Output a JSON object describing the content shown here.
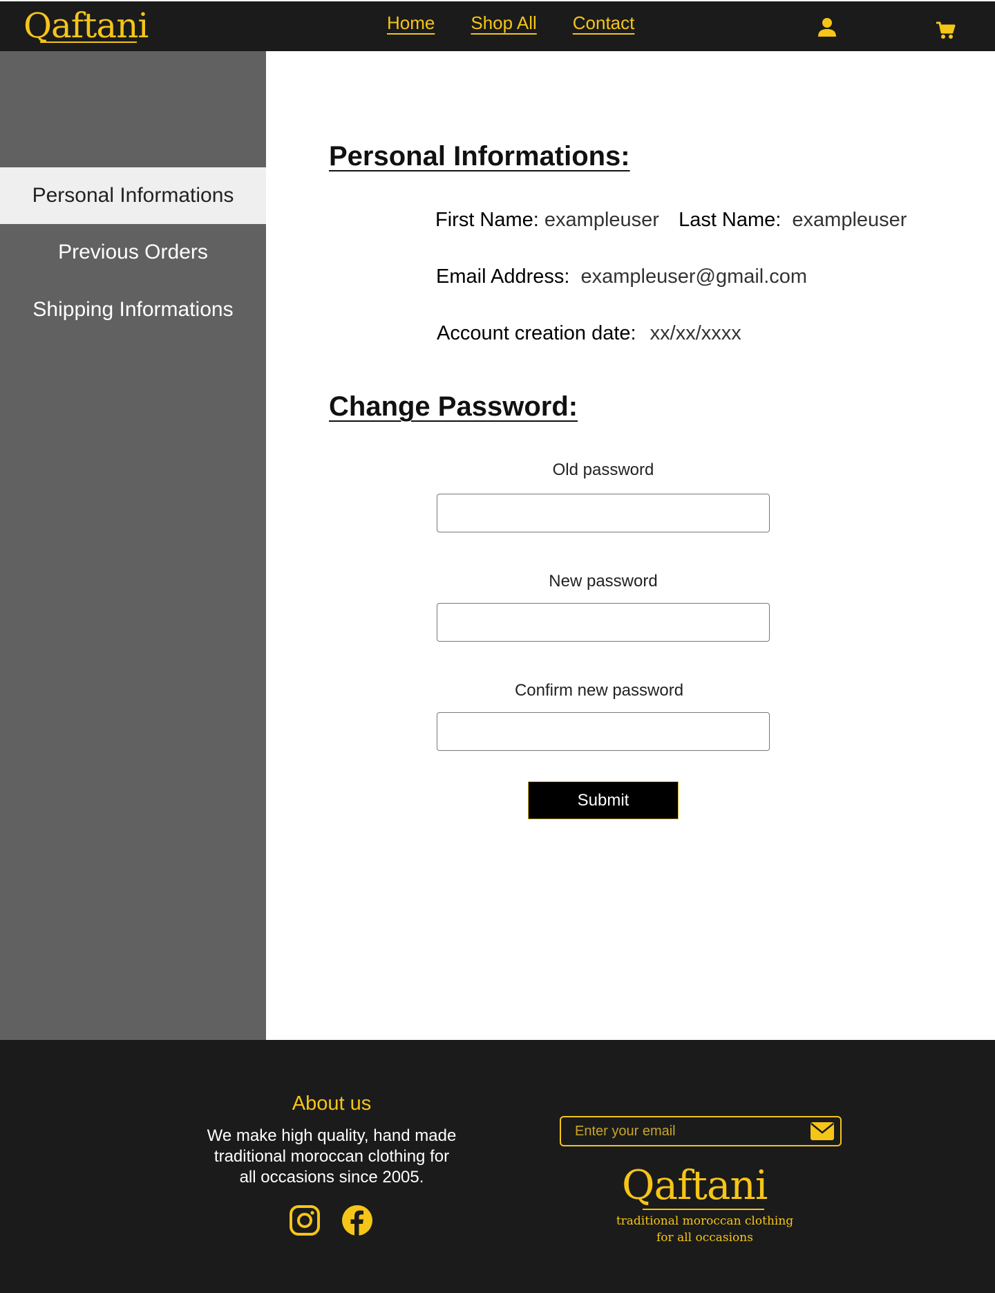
{
  "brand": {
    "name": "Qaftani",
    "tagline_line1": "traditional moroccan clothing",
    "tagline_line2": "for all occasions"
  },
  "colors": {
    "accent": "#f5c518",
    "header_bg": "#1b1b1b",
    "sidebar_bg": "#616161",
    "sidebar_active_bg": "#efefef"
  },
  "nav": {
    "items": [
      {
        "label": "Home"
      },
      {
        "label": "Shop All"
      },
      {
        "label": "Contact"
      }
    ]
  },
  "header_icons": {
    "user": "user-icon",
    "cart": "cart-icon"
  },
  "sidebar": {
    "items": [
      {
        "label": "Personal Informations",
        "active": true
      },
      {
        "label": "Previous Orders",
        "active": false
      },
      {
        "label": "Shipping Informations",
        "active": false
      }
    ]
  },
  "personal": {
    "title": "Personal Informations:",
    "first_name_label": "First Name:",
    "first_name_value": "exampleuser",
    "last_name_label": "Last Name:",
    "last_name_value": "exampleuser",
    "email_label": "Email Address:",
    "email_value": "exampleuser@gmail.com",
    "created_label": "Account creation date:",
    "created_value": "xx/xx/xxxx"
  },
  "password": {
    "title": "Change Password:",
    "old_label": "Old password",
    "new_label": "New password",
    "confirm_label": "Confirm new password",
    "submit_label": "Submit"
  },
  "footer": {
    "about_title": "About us",
    "about_text_1": "We make high quality, hand made",
    "about_text_2": "traditional moroccan clothing for",
    "about_text_3": "all occasions since 2005.",
    "email_placeholder": "Enter your email",
    "social": [
      "instagram-icon",
      "facebook-icon"
    ]
  }
}
